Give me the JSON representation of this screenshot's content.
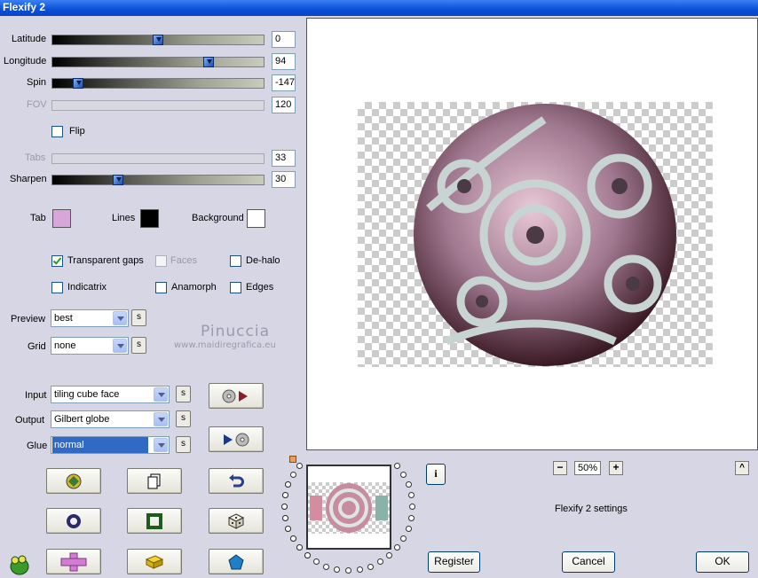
{
  "window": {
    "title": "Flexify 2"
  },
  "sliders": [
    {
      "label": "Latitude",
      "value": "0",
      "fraction": 0.5,
      "enabled": true
    },
    {
      "label": "Longitude",
      "value": "94",
      "fraction": 0.75,
      "enabled": true
    },
    {
      "label": "Spin",
      "value": "-147",
      "fraction": 0.1,
      "enabled": true
    },
    {
      "label": "FOV",
      "value": "120",
      "fraction": 0.0,
      "enabled": false
    }
  ],
  "flip": {
    "label": "Flip",
    "checked": false
  },
  "sliders2": [
    {
      "label": "Tabs",
      "value": "33",
      "fraction": 0.0,
      "enabled": false
    },
    {
      "label": "Sharpen",
      "value": "30",
      "fraction": 0.3,
      "enabled": true
    }
  ],
  "colors": {
    "tab": {
      "label": "Tab",
      "color": "#d9a6dc"
    },
    "lines": {
      "label": "Lines",
      "color": "#000000"
    },
    "background": {
      "label": "Background",
      "color": "#ffffff"
    }
  },
  "options": {
    "transparent_gaps": {
      "label": "Transparent gaps",
      "checked": true
    },
    "faces": {
      "label": "Faces",
      "checked": false
    },
    "de_halo": {
      "label": "De-halo",
      "checked": false
    },
    "indicatrix": {
      "label": "Indicatrix",
      "checked": false
    },
    "anamorph": {
      "label": "Anamorph",
      "checked": false
    },
    "edges": {
      "label": "Edges",
      "checked": false
    }
  },
  "preview_select": {
    "label": "Preview",
    "value": "best",
    "s": "s"
  },
  "grid_select": {
    "label": "Grid",
    "value": "none",
    "s": "s"
  },
  "watermark": {
    "name": "Pinuccia",
    "site": "www.maidiregrafica.eu"
  },
  "input_select": {
    "label": "Input",
    "value": "tiling cube face",
    "s": "s"
  },
  "output_select": {
    "label": "Output",
    "value": "Gilbert globe",
    "s": "s"
  },
  "glue_select": {
    "label": "Glue",
    "value": "normal",
    "s": "s"
  },
  "zoom": {
    "value": "50%",
    "minus": "−",
    "plus": "+",
    "up": "^"
  },
  "settings_name": "Flexify 2 settings",
  "info": "i",
  "buttons": {
    "register": "Register",
    "cancel": "Cancel",
    "ok": "OK"
  }
}
